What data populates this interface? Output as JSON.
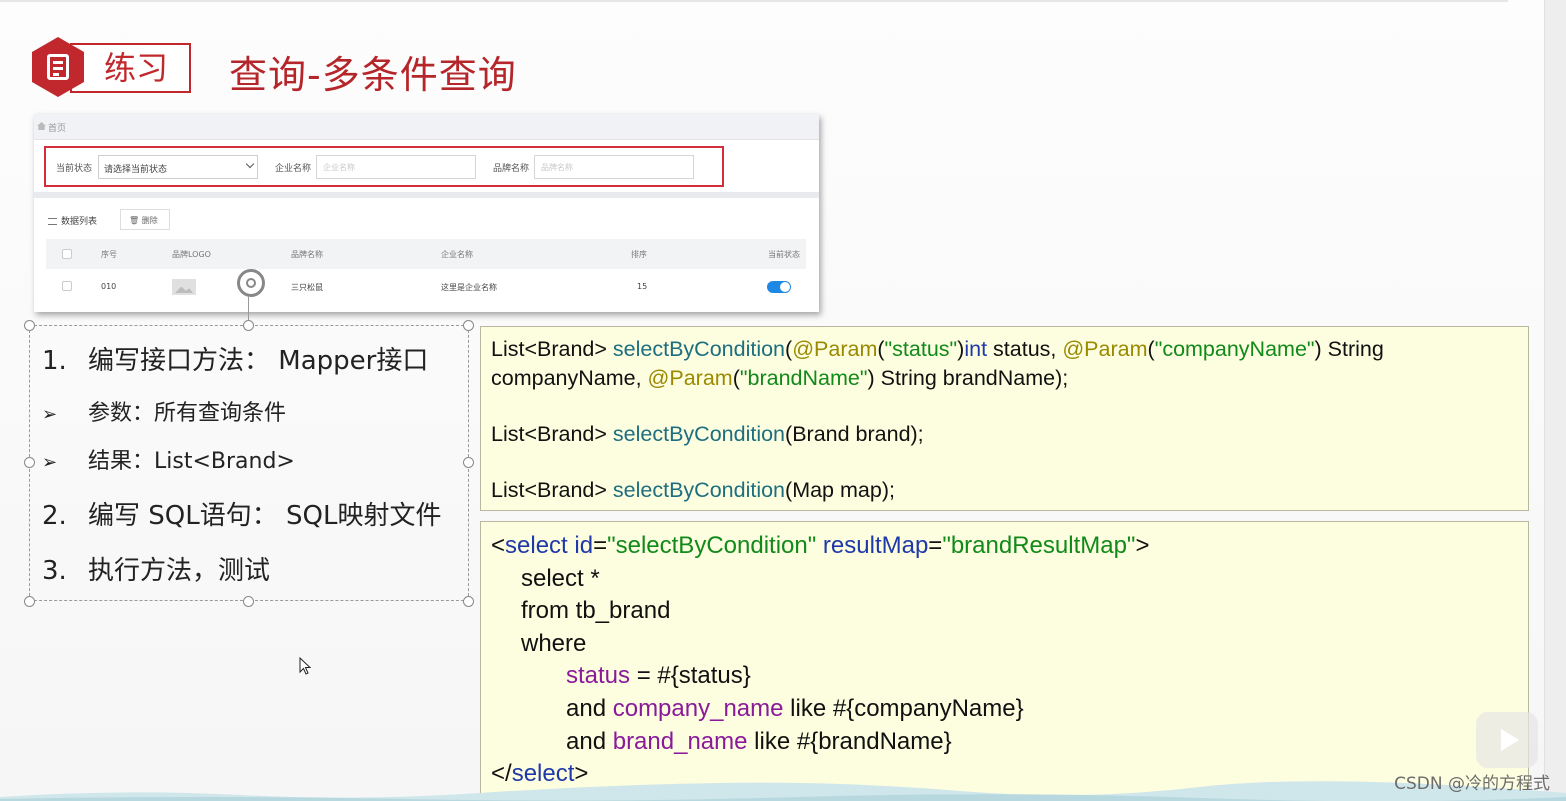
{
  "header": {
    "badge_label": "练习",
    "title": "查询-多条件查询"
  },
  "screenshot": {
    "breadcrumb": "首页",
    "filters": {
      "status_label": "当前状态",
      "status_value": "请选择当前状态",
      "company_label": "企业名称",
      "company_placeholder": "企业名称",
      "brand_label": "品牌名称",
      "brand_placeholder": "品牌名称"
    },
    "list_title": "数据列表",
    "delete_label": "删除",
    "columns": [
      "序号",
      "品牌LOGO",
      "品牌名称",
      "企业名称",
      "排序",
      "当前状态"
    ],
    "row": {
      "id": "010",
      "brand_name": "三只松鼠",
      "company_name": "这里是企业名称",
      "order": "15",
      "status_on": true
    }
  },
  "steps": [
    {
      "marker": "1.",
      "text": "编写接口方法： Mapper接口"
    },
    {
      "marker": "➢",
      "text": "参数：所有查询条件"
    },
    {
      "marker": "➢",
      "text": "结果：List<Brand>"
    },
    {
      "marker": "2.",
      "text": "编写 SQL语句： SQL映射文件"
    },
    {
      "marker": "3.",
      "text": "执行方法，测试"
    }
  ],
  "code_java": {
    "line1_a": "List<Brand> ",
    "line1_method": "selectByCondition",
    "line1_b": "(",
    "ann": "@Param",
    "p1_open": "(",
    "p1_str": "\"status\"",
    "p1_close": ")",
    "p1_type": "int",
    "p1_rest": " status, ",
    "p2_str": "\"companyName\"",
    "p2_rest": ") String",
    "line2_a": "companyName, ",
    "p3_str": "\"brandName\"",
    "line2_rest": ") String brandName);",
    "line3_a": "List<Brand> ",
    "line3_method": "selectByCondition",
    "line3_rest": "(Brand brand);",
    "line4_a": "List<Brand> ",
    "line4_method": "selectByCondition",
    "line4_rest": "(Map map);"
  },
  "code_xml": {
    "open_lt": "<",
    "tag": "select",
    "attr_id": " id",
    "eq": "=",
    "id_val": "\"selectByCondition\"",
    "attr_rm": " resultMap",
    "rm_val": "\"brandResultMap\"",
    "open_gt": ">",
    "l_select": "select *",
    "l_from": "from tb_brand",
    "l_where": "where",
    "c1_col": "status",
    "c1_rest": " = #{status}",
    "c2_and": "and ",
    "c2_col": "company_name",
    "c2_rest": " like #{companyName}",
    "c3_and": "and ",
    "c3_col": "brand_name",
    "c3_rest": " like #{brandName}",
    "close_lt": "</",
    "close_gt": ">"
  },
  "watermark": "CSDN @冷的方程式",
  "colors": {
    "brand_red": "#c0282d",
    "code_bg": "#fdfde0",
    "method_teal": "#1d6f80",
    "annotation_olive": "#9a8a00",
    "string_green": "#118a1a",
    "keyword_navy": "#1f3aa8",
    "column_purple": "#8a1a9a"
  }
}
